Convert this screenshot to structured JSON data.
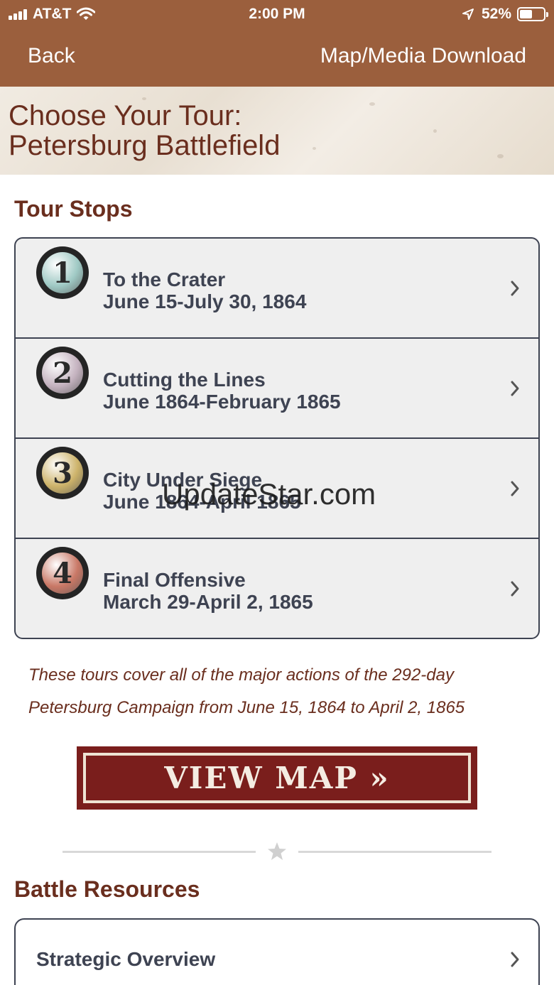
{
  "status": {
    "carrier": "AT&T",
    "time": "2:00 PM",
    "battery": "52%",
    "battery_level": 0.52
  },
  "nav": {
    "back_label": "Back",
    "download_label": "Map/Media Download"
  },
  "hero": {
    "title_line1": "Choose Your Tour:",
    "title_line2": "Petersburg Battlefield"
  },
  "tour_stops": {
    "heading": "Tour Stops",
    "items": [
      {
        "number": "1",
        "title": "To the Crater",
        "dates": "June 15-July 30, 1864",
        "badge_color": "#9fc9c4"
      },
      {
        "number": "2",
        "title": "Cutting the Lines",
        "dates": "June 1864-February 1865",
        "badge_color": "#c4b2bf"
      },
      {
        "number": "3",
        "title": "City Under Siege",
        "dates": "June 1864-April 1865",
        "badge_color": "#cdb36a"
      },
      {
        "number": "4",
        "title": "Final Offensive",
        "dates": "March 29-April 2, 1865",
        "badge_color": "#c97866"
      }
    ]
  },
  "watermark": "UpdateStar.com",
  "description": {
    "line1": "These tours cover all of the major actions of the 292-day",
    "line2": "Petersburg Campaign from June 15, 1864 to April 2, 1865"
  },
  "view_map": {
    "label": "VIEW MAP »"
  },
  "battle_resources": {
    "heading": "Battle Resources",
    "items": [
      {
        "label": "Strategic Overview"
      }
    ]
  },
  "colors": {
    "brand_brown": "#9b5f3d",
    "heading_brown": "#6a2e1e",
    "button_red": "#7a1e1c",
    "list_text": "#3e4352"
  }
}
